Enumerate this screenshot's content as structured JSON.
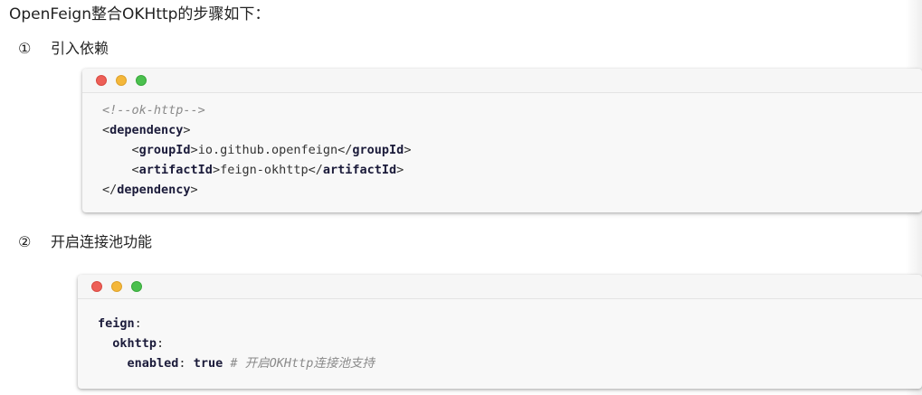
{
  "heading": "OpenFeign整合OKHttp的步骤如下：",
  "steps": [
    {
      "number": "①",
      "label": "引入依赖"
    },
    {
      "number": "②",
      "label": "开启连接池功能"
    }
  ],
  "code_blocks": {
    "xml": {
      "comment": "<!--ok-http-->",
      "dependency_tag": "dependency",
      "group_tag": "groupId",
      "group_value": "io.github.openfeign",
      "artifact_tag": "artifactId",
      "artifact_value": "feign-okhttp"
    },
    "yaml": {
      "key_feign": "feign",
      "key_okhttp": "okhttp",
      "key_enabled": "enabled",
      "value_enabled": "true",
      "comment": "# 开启OKHttp连接池支持"
    }
  },
  "window_dots": [
    "red",
    "yellow",
    "green"
  ],
  "colors": {
    "dot_red": "#ed5f57",
    "dot_yellow": "#f4b73a",
    "dot_green": "#4bc04e"
  }
}
